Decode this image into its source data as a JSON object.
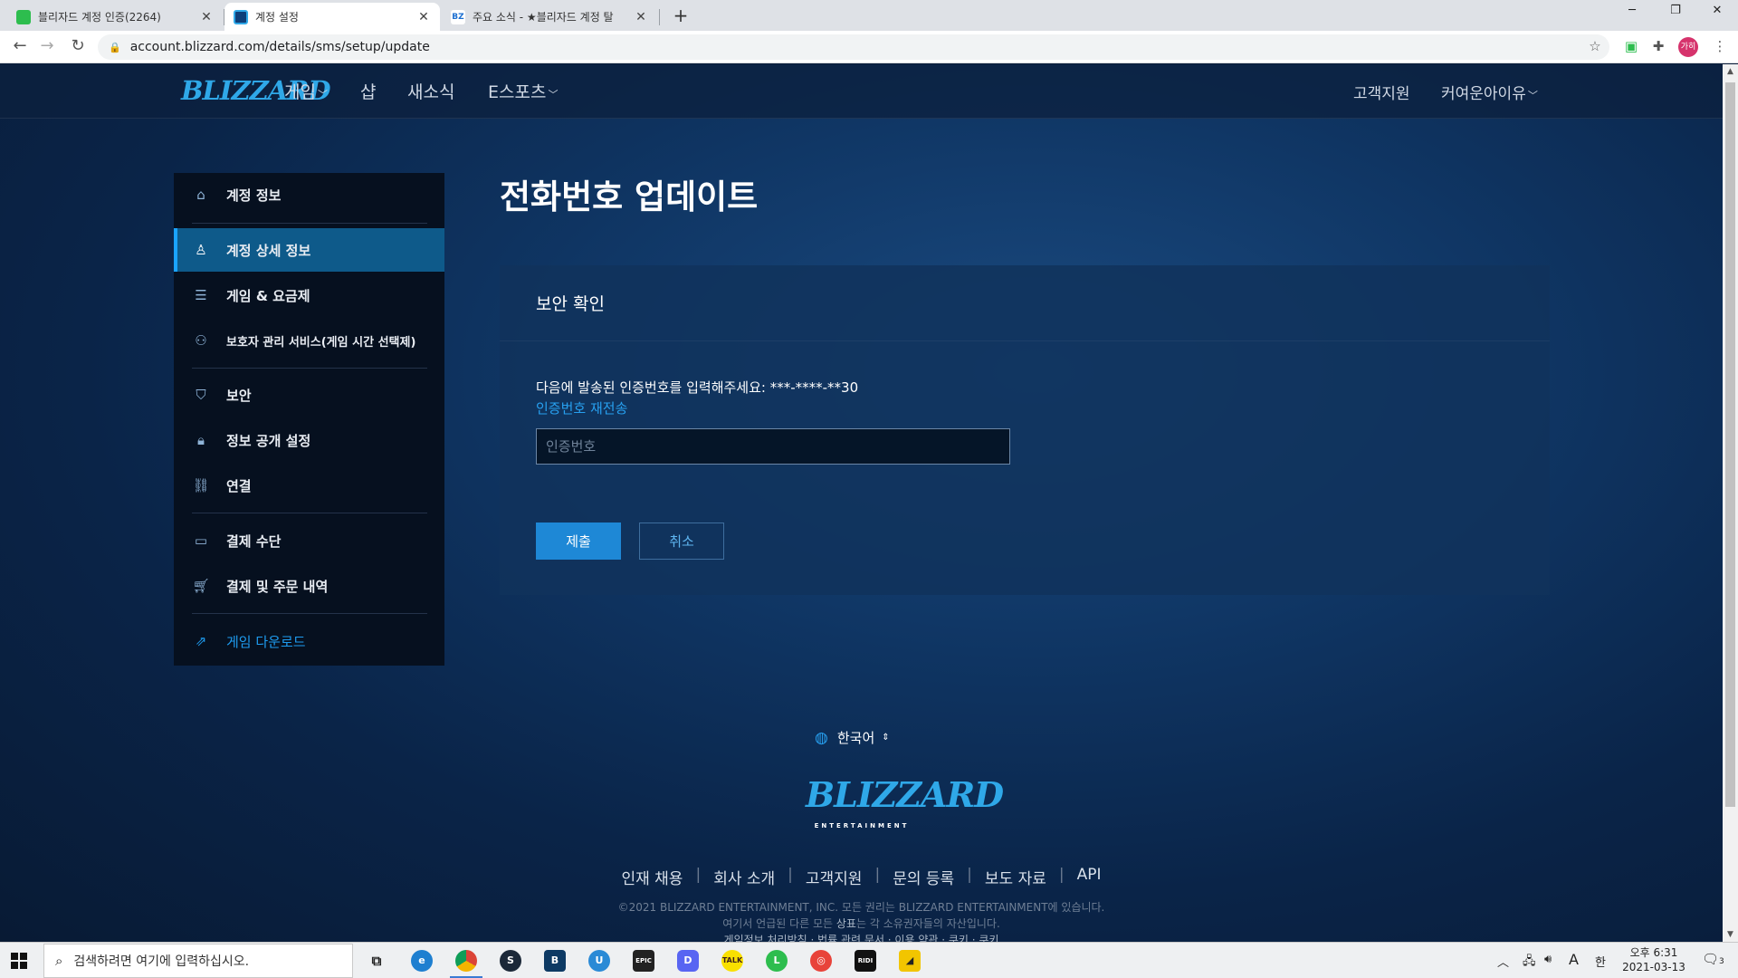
{
  "browser": {
    "tabs": [
      {
        "title": "블리자드 계정 인증(2264)",
        "active": false
      },
      {
        "title": "계정 설정",
        "active": true
      },
      {
        "title": "주요 소식 - ★블리자드 계정 탈",
        "active": false
      }
    ],
    "new_tab_label": "+",
    "url": "account.blizzard.com/details/sms/setup/update",
    "profile_initials": "가히"
  },
  "global_nav": {
    "logo": "BLIZZARD",
    "items": [
      {
        "label": "게임",
        "dropdown": true
      },
      {
        "label": "샵",
        "dropdown": false
      },
      {
        "label": "새소식",
        "dropdown": false
      },
      {
        "label": "E스포츠",
        "dropdown": true
      }
    ],
    "support": "고객지원",
    "account": "커여운아이유"
  },
  "sidebar": {
    "items": [
      {
        "label": "계정 정보",
        "icon": "home-icon"
      },
      {
        "label": "계정 상세 정보",
        "icon": "user-icon",
        "active": true
      },
      {
        "label": "게임 & 요금제",
        "icon": "list-icon"
      },
      {
        "label": "보호자 관리 서비스(게임 시간 선택제)",
        "icon": "users-icon"
      },
      {
        "label": "보안",
        "icon": "shield-icon"
      },
      {
        "label": "정보 공개 설정",
        "icon": "lock-icon"
      },
      {
        "label": "연결",
        "icon": "link-icon"
      },
      {
        "label": "결제 수단",
        "icon": "credit-card-icon"
      },
      {
        "label": "결제 및 주문 내역",
        "icon": "cart-icon"
      },
      {
        "label": "게임 다운로드",
        "icon": "external-link-icon"
      }
    ]
  },
  "main": {
    "title": "전화번호 업데이트",
    "card_title": "보안 확인",
    "prompt": "다음에 발송된 인증번호를 입력해주세요: ***-****-**30",
    "resend_link": "인증번호 재전송",
    "code_placeholder": "인증번호",
    "submit_label": "제출",
    "cancel_label": "취소"
  },
  "footer": {
    "language": "한국어",
    "logo": "BLIZZARD",
    "logo_sub": "ENTERTAINMENT",
    "links": [
      "인재 채용",
      "회사 소개",
      "고객지원",
      "문의 등록",
      "보도 자료",
      "API"
    ],
    "copyright_1": "©2021 BLIZZARD ENTERTAINMENT, INC. 모든 권리는 BLIZZARD ENTERTAINMENT에 있습니다.",
    "copyright_2_pre": "여기서 언급된 다른 모든 ",
    "copyright_2_bold": "상표",
    "copyright_2_post": "는 각 소유권자들의 자산입니다.",
    "links_2": "게임정보 처리방침 · 법률 관련 문서 · 이용 약관 · 쿠키 · 쿠키"
  },
  "taskbar": {
    "search_placeholder": "검색하려면 여기에 입력하십시오.",
    "ime_mode": "A",
    "ime_lang": "한",
    "time": "오후 6:31",
    "date": "2021-03-13",
    "notification_count": "3"
  },
  "colors": {
    "accent": "#1e88d6",
    "link": "#27a0f0",
    "sidebar_bg": "#06101f",
    "active_item": "#0e5a8a"
  }
}
